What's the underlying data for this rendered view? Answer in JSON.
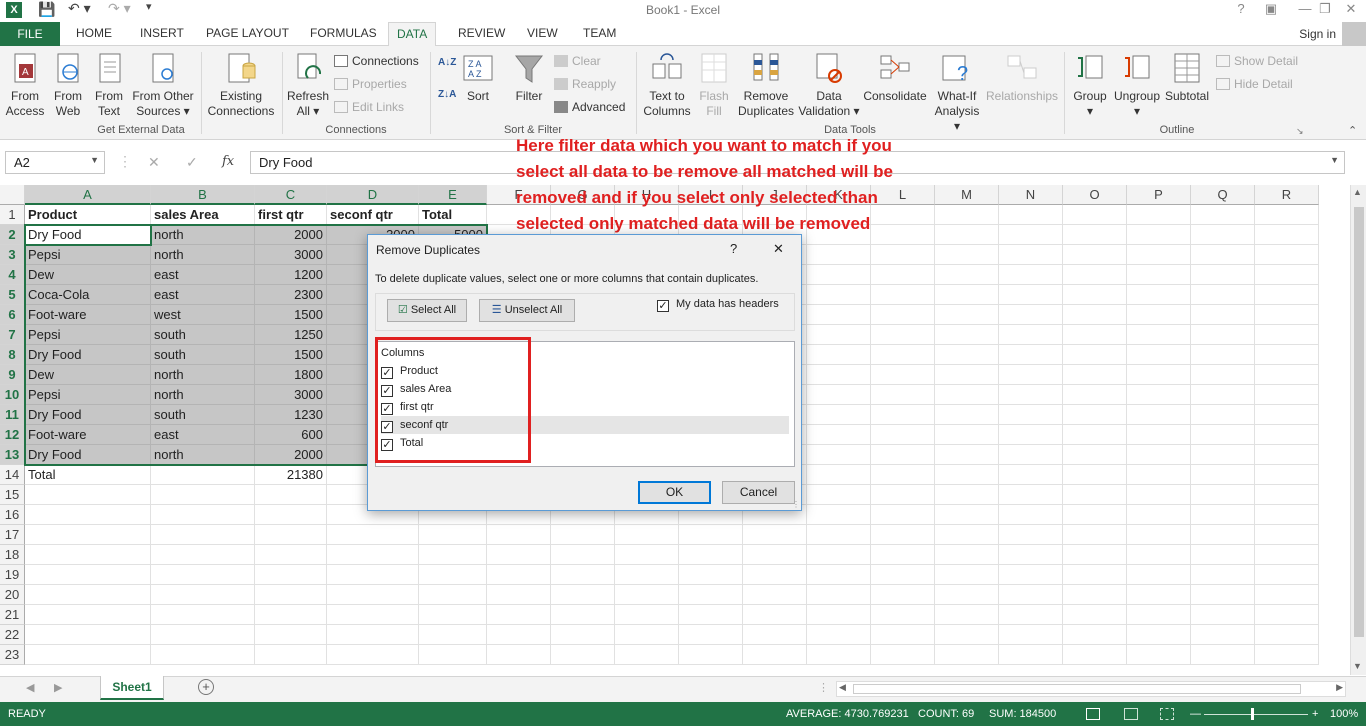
{
  "window": {
    "title": "Book1 - Excel"
  },
  "qat": {
    "save": "save-icon",
    "undo": "undo-icon",
    "redo": "redo-icon"
  },
  "tabs": {
    "file": "FILE",
    "items": [
      "HOME",
      "INSERT",
      "PAGE LAYOUT",
      "FORMULAS",
      "DATA",
      "REVIEW",
      "VIEW",
      "TEAM"
    ],
    "active": "DATA",
    "signin": "Sign in"
  },
  "ribbon": {
    "get_external": {
      "group": "Get External Data",
      "from_access": [
        "From",
        "Access"
      ],
      "from_web": [
        "From",
        "Web"
      ],
      "from_text": [
        "From",
        "Text"
      ],
      "from_other": [
        "From Other",
        "Sources ▾"
      ],
      "existing": [
        "Existing",
        "Connections"
      ]
    },
    "connections": {
      "group": "Connections",
      "refresh": [
        "Refresh",
        "All ▾"
      ],
      "connections": "Connections",
      "properties": "Properties",
      "edit_links": "Edit Links"
    },
    "sort_filter": {
      "group": "Sort & Filter",
      "sort": "Sort",
      "filter": "Filter",
      "clear": "Clear",
      "reapply": "Reapply",
      "advanced": "Advanced",
      "az": "A↓Z",
      "za": "Z↓A"
    },
    "data_tools": {
      "group": "Data Tools",
      "text_to_columns": [
        "Text to",
        "Columns"
      ],
      "flash_fill": [
        "Flash",
        "Fill"
      ],
      "remove_duplicates": [
        "Remove",
        "Duplicates"
      ],
      "data_validation": [
        "Data",
        "Validation ▾"
      ],
      "consolidate": "Consolidate",
      "what_if": [
        "What-If",
        "Analysis ▾"
      ],
      "relationships": "Relationships"
    },
    "outline": {
      "group": "Outline",
      "group_btn": [
        "Group",
        "▾"
      ],
      "ungroup": [
        "Ungroup",
        "▾"
      ],
      "subtotal": "Subtotal",
      "show_detail": "Show Detail",
      "hide_detail": "Hide Detail"
    }
  },
  "formula_bar": {
    "name_box": "A2",
    "fx": "fx",
    "value": "Dry Food",
    "cancel": "✕",
    "enter": "✓"
  },
  "columns": [
    "A",
    "B",
    "C",
    "D",
    "E",
    "F",
    "G",
    "H",
    "I",
    "J",
    "K",
    "L",
    "M",
    "N",
    "O",
    "P",
    "Q",
    "R"
  ],
  "rows": [
    "1",
    "2",
    "3",
    "4",
    "5",
    "6",
    "7",
    "8",
    "9",
    "10",
    "11",
    "12",
    "13",
    "14",
    "15",
    "16",
    "17",
    "18",
    "19",
    "20",
    "21",
    "22",
    "23"
  ],
  "table": {
    "headers": [
      "Product",
      "sales Area",
      "first qtr",
      "seconf qtr",
      "Total"
    ],
    "data": [
      [
        "Dry Food",
        "north",
        "2000",
        "3000",
        "5000"
      ],
      [
        "Pepsi",
        "north",
        "3000",
        "",
        ""
      ],
      [
        "Dew",
        "east",
        "1200",
        "",
        ""
      ],
      [
        "Coca-Cola",
        "east",
        "2300",
        "",
        ""
      ],
      [
        "Foot-ware",
        "west",
        "1500",
        "",
        ""
      ],
      [
        "Pepsi",
        "south",
        "1250",
        "",
        ""
      ],
      [
        "Dry Food",
        "south",
        "1500",
        "",
        ""
      ],
      [
        "Dew",
        "north",
        "1800",
        "",
        ""
      ],
      [
        "Pepsi",
        "north",
        "3000",
        "",
        ""
      ],
      [
        "Dry Food",
        "south",
        "1230",
        "",
        ""
      ],
      [
        "Foot-ware",
        "east",
        "600",
        "",
        ""
      ],
      [
        "Dry Food",
        "north",
        "2000",
        "",
        ""
      ]
    ],
    "total_row": [
      "Total",
      "",
      "21380",
      "",
      ""
    ]
  },
  "annotation": "Here filter data which you want to match if you select all data to be remove all matched will be removed and if you select only selected than selected only matched data will be removed",
  "dialog": {
    "title": "Remove Duplicates",
    "help": "?",
    "close": "✕",
    "description": "To delete duplicate values, select one or more columns that contain duplicates.",
    "select_all": "Select All",
    "unselect_all": "Unselect All",
    "has_headers": "My data has headers",
    "columns_label": "Columns",
    "columns": [
      "Product",
      "sales Area",
      "first qtr",
      "seconf qtr",
      "Total"
    ],
    "ok": "OK",
    "cancel": "Cancel"
  },
  "sheets": {
    "active": "Sheet1",
    "add": "+"
  },
  "status": {
    "ready": "READY",
    "average": "AVERAGE: 4730.769231",
    "count": "COUNT: 69",
    "sum": "SUM: 184500",
    "zoom": "100%"
  },
  "colors": {
    "accent": "#217346",
    "annotation": "#e02020"
  }
}
